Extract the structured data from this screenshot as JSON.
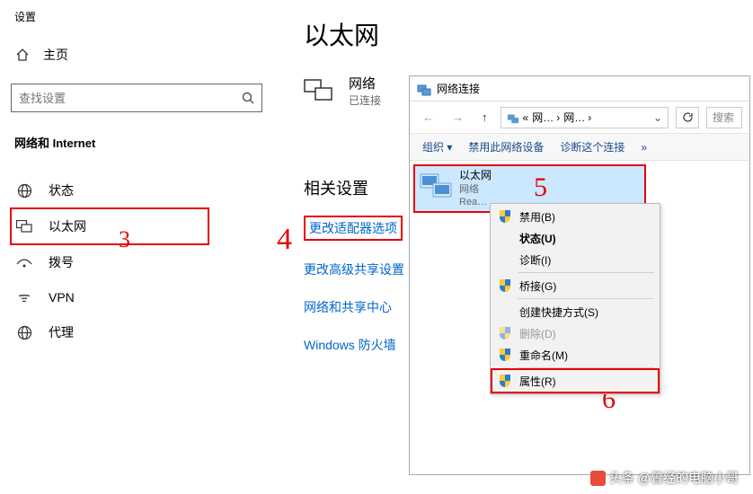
{
  "sidebar": {
    "settings_title": "设置",
    "home_label": "主页",
    "search_placeholder": "查找设置",
    "section": "网络和 Internet",
    "items": [
      {
        "label": "状态"
      },
      {
        "label": "以太网"
      },
      {
        "label": "拨号"
      },
      {
        "label": "VPN"
      },
      {
        "label": "代理"
      }
    ]
  },
  "main": {
    "title": "以太网",
    "network_name": "网络",
    "network_status": "已连接",
    "related_head": "相关设置",
    "links": {
      "adapter": "更改适配器选项",
      "sharing": "更改高级共享设置",
      "center": "网络和共享中心",
      "firewall": "Windows 防火墙"
    }
  },
  "ncwin": {
    "title": "网络连接",
    "bread1": "网…",
    "bread2": "网…",
    "search_ph": "搜索",
    "toolbar": {
      "organize": "组织 ▾",
      "disable": "禁用此网络设备",
      "diagnose": "诊断这个连接",
      "more": "»"
    },
    "adapter": {
      "name": "以太网",
      "sub1": "网络",
      "sub2": "Rea…"
    }
  },
  "ctx": {
    "disable": "禁用(B)",
    "status": "状态(U)",
    "diagnose": "诊断(I)",
    "bridge": "桥接(G)",
    "shortcut": "创建快捷方式(S)",
    "delete": "删除(D)",
    "rename": "重命名(M)",
    "props": "属性(R)"
  },
  "annotations": {
    "a3": "3",
    "a4": "4",
    "a5": "5",
    "a6": "6"
  },
  "watermark": "头条 @曾经的电脑小哥"
}
